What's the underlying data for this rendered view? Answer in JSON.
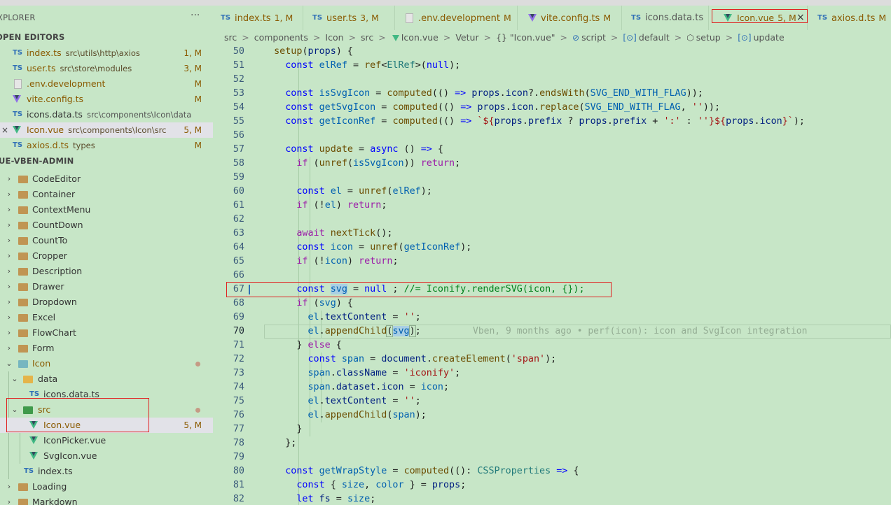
{
  "explorer": {
    "title": "XPLORER",
    "more_icon": "···",
    "open_editors_label": "OPEN EDITORS",
    "project_label": "UE-VBEN-ADMIN",
    "open_editors": [
      {
        "badge": "TS",
        "name": "index.ts",
        "path": "src\\utils\\http\\axios",
        "status": "1, M"
      },
      {
        "badge": "TS",
        "name": "user.ts",
        "path": "src\\store\\modules",
        "status": "3, M"
      },
      {
        "badge": "",
        "name": ".env.development",
        "path": "",
        "status": "M"
      },
      {
        "badge": "",
        "name": "vite.config.ts",
        "path": "",
        "status": "M"
      },
      {
        "badge": "TS",
        "name": "icons.data.ts",
        "path": "src\\components\\Icon\\data",
        "status": ""
      },
      {
        "badge": "",
        "name": "Icon.vue",
        "path": "src\\components\\Icon\\src",
        "status": "5, M",
        "close": "×"
      },
      {
        "badge": "TS",
        "name": "axios.d.ts",
        "path": "types",
        "status": "M"
      }
    ],
    "tree": [
      "CodeEditor",
      "Container",
      "ContextMenu",
      "CountDown",
      "CountTo",
      "Cropper",
      "Description",
      "Drawer",
      "Dropdown",
      "Excel",
      "FlowChart",
      "Form",
      "Icon",
      "data",
      "icons.data.ts",
      "src",
      "Icon.vue",
      "IconPicker.vue",
      "SvgIcon.vue",
      "index.ts",
      "Loading",
      "Markdown"
    ],
    "icon_vue_status": "5, M",
    "ts_badge": "TS"
  },
  "tabs": [
    {
      "badge": "TS",
      "label": "index.ts",
      "status": "1, M"
    },
    {
      "badge": "TS",
      "label": "user.ts",
      "status": "3, M"
    },
    {
      "badge": "",
      "label": ".env.development",
      "status": "M"
    },
    {
      "badge": "",
      "label": "vite.config.ts",
      "status": "M"
    },
    {
      "badge": "TS",
      "label": "icons.data.ts",
      "status": ""
    },
    {
      "badge": "",
      "label": "Icon.vue",
      "status": "5, M",
      "close": "×"
    },
    {
      "badge": "TS",
      "label": "axios.d.ts",
      "status": "M"
    }
  ],
  "breadcrumb": {
    "parts": [
      "src",
      "components",
      "Icon",
      "src",
      "Icon.vue",
      "Vetur",
      "{} \"Icon.vue\"",
      "script",
      "default",
      "setup",
      "update"
    ],
    "sep": ">"
  },
  "editor": {
    "line_numbers": [
      "50",
      "51",
      "52",
      "53",
      "54",
      "55",
      "56",
      "57",
      "58",
      "59",
      "60",
      "61",
      "62",
      "63",
      "64",
      "65",
      "66",
      "67",
      "68",
      "69",
      "70",
      "71",
      "72",
      "73",
      "74",
      "75",
      "76",
      "77",
      "78",
      "79",
      "80",
      "81",
      "82"
    ],
    "blame": "Vben, 9 months ago • perf(icon): icon and SvgIcon integration",
    "colors": {
      "highlight_box": "#e02020",
      "background": "#c7e6c7"
    }
  }
}
